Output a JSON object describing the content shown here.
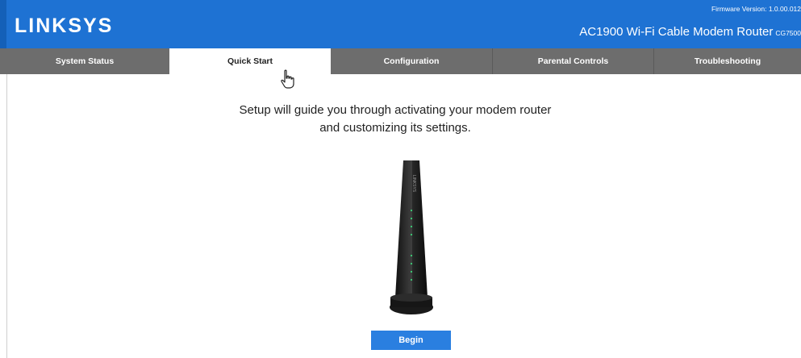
{
  "header": {
    "logo": "LINKSYS",
    "firmware": "Firmware Version: 1.0.00.012",
    "model": "AC1900 Wi-Fi Cable Modem Router",
    "model_code": "CG7500"
  },
  "tabs": [
    {
      "label": "System Status",
      "active": false
    },
    {
      "label": "Quick Start",
      "active": true
    },
    {
      "label": "Configuration",
      "active": false
    },
    {
      "label": "Parental Controls",
      "active": false
    },
    {
      "label": "Troubleshooting",
      "active": false
    }
  ],
  "main": {
    "intro_line1": "Setup will guide you through activating your modem router",
    "intro_line2": "and customizing its settings.",
    "device_label": "LINKSYS",
    "begin_label": "Begin"
  },
  "colors": {
    "header_blue": "#1e72d3",
    "tab_gray": "#6d6d6d",
    "button_blue": "#2a7fe0"
  }
}
